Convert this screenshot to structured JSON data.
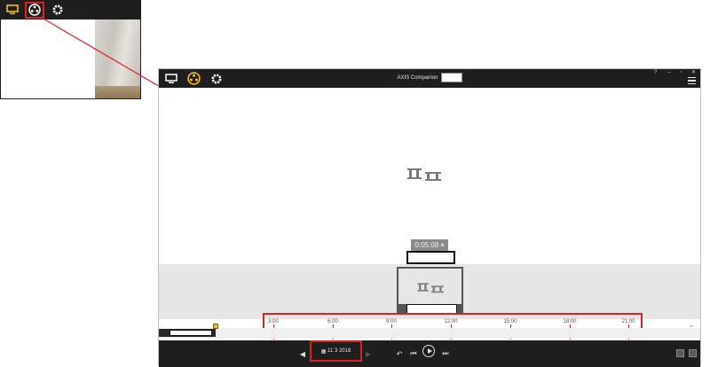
{
  "inset": {
    "icons": [
      "monitor-icon",
      "film-reel-icon",
      "gear-icon"
    ]
  },
  "app": {
    "title": "AXIS Companion",
    "window_controls": [
      "?",
      "–",
      "▫",
      "✕"
    ],
    "toolbar_icons": [
      "monitor-icon",
      "film-reel-icon",
      "gear-icon"
    ],
    "recording_time": "0:05:08",
    "timeline_ticks": [
      "3:00",
      "6:00",
      "9:00",
      "12:00",
      "15:00",
      "18:00",
      "21:00"
    ],
    "date_label": "11 3 2018",
    "colors": {
      "accent": "#f0c020",
      "highlight": "#e02020",
      "bar": "#1e1e1e"
    }
  }
}
